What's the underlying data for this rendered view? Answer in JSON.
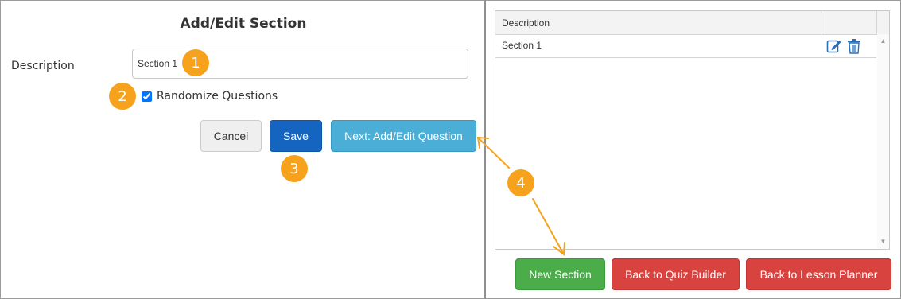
{
  "form": {
    "title": "Add/Edit Section",
    "description_label": "Description",
    "description_value": "Section 1",
    "randomize_label": "Randomize Questions",
    "randomize_checked": true,
    "cancel_label": "Cancel",
    "save_label": "Save",
    "next_label": "Next: Add/Edit Question"
  },
  "grid": {
    "header": "Description",
    "rows": [
      {
        "description": "Section 1",
        "actions": [
          "edit-icon",
          "trash-icon"
        ]
      }
    ]
  },
  "footer": {
    "new_section_label": "New Section",
    "back_quiz_label": "Back to Quiz Builder",
    "back_lesson_label": "Back to Lesson Planner"
  },
  "annotations": {
    "n1": "1",
    "n2": "2",
    "n3": "3",
    "n4": "4"
  },
  "colors": {
    "callout": "#f7a21c",
    "save": "#1565c0",
    "next": "#4aaed6",
    "new_section": "#4aad4a",
    "back": "#d9433f"
  }
}
